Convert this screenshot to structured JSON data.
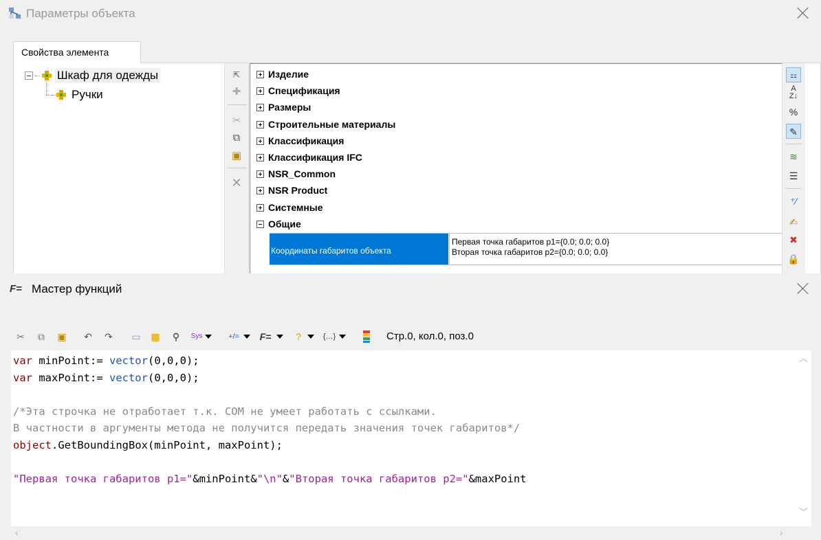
{
  "object_window": {
    "title": "Параметры объекта",
    "tab_label": "Свойства элемента",
    "tree": {
      "root": "Шкаф для одежды",
      "child": "Ручки"
    },
    "categories": [
      {
        "label": "Изделие",
        "expanded": false
      },
      {
        "label": "Спецификация",
        "expanded": false
      },
      {
        "label": "Размеры",
        "expanded": false
      },
      {
        "label": "Строительные материалы",
        "expanded": false
      },
      {
        "label": "Классификация",
        "expanded": false
      },
      {
        "label": "Классификация IFC",
        "expanded": false
      },
      {
        "label": "NSR_Common",
        "expanded": false
      },
      {
        "label": "NSR Product",
        "expanded": false
      },
      {
        "label": "Системные",
        "expanded": false
      },
      {
        "label": "Общие",
        "expanded": true
      }
    ],
    "selected_property": {
      "name": "Координаты габаритов объекта",
      "value_line1": "Первая точка габаритов p1={0.0; 0.0; 0.0}",
      "value_line2": "Вторая точка габаритов p2={0.0; 0.0; 0.0}"
    },
    "selection_color": "#0078d7"
  },
  "function_wizard": {
    "title": "Мастер функций",
    "status": "Стр.0, кол.0, поз.0",
    "code": {
      "line1_kw": "var",
      "line1_id": " minPoint:= ",
      "line1_fn": "vector",
      "line1_args": "(0,0,0);",
      "line2_kw": "var",
      "line2_id": " maxPoint:= ",
      "line2_fn": "vector",
      "line2_args": "(0,0,0);",
      "comment1": "/*Эта строчка не отработает т.к. COM не умеет работать с ссылками.",
      "comment2": "В частности в аргументы метода не получится передать значения точек габаритов*/",
      "line5_obj": "object",
      "line5_rest": ".GetBoundingBox(minPoint, maxPoint);",
      "line7_s1": "\"Первая точка габаритов p1=\"",
      "line7_a": "&minPoint&",
      "line7_s2": "\"\\n\"",
      "line7_b": "&",
      "line7_s3": "\"Вторая точка габаритов p2=\"",
      "line7_c": "&maxPoint"
    },
    "colors": {
      "keyword": "#8b0000",
      "function": "#1f52c2",
      "comment": "#8a8a8a",
      "string": "#a0209a"
    }
  }
}
